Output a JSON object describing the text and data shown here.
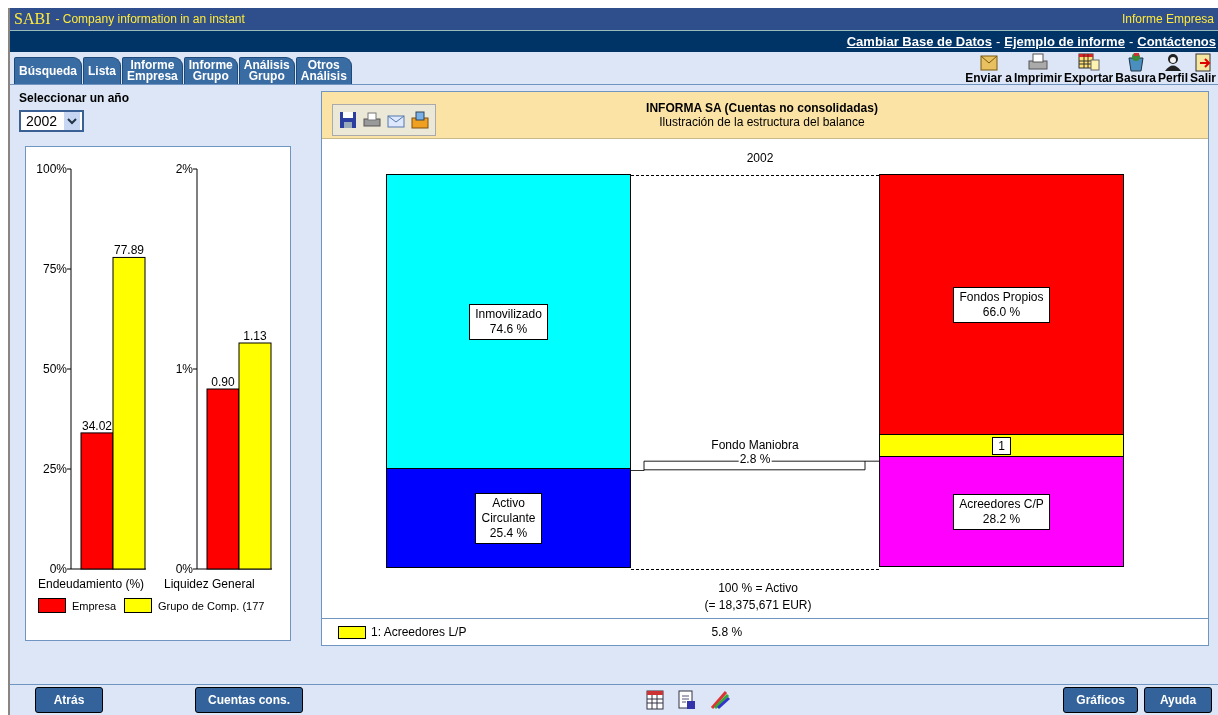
{
  "header": {
    "brand": "SABI",
    "tagline": "- Company information in an instant",
    "section": "Informe Empresa"
  },
  "nav_links": [
    {
      "kind": "link",
      "text": "Cambiar Base de Datos"
    },
    {
      "kind": "separator",
      "text": "-"
    },
    {
      "kind": "link",
      "text": "Ejemplo de informe"
    },
    {
      "kind": "separator",
      "text": "-"
    },
    {
      "kind": "link",
      "text": "Contáctenos"
    }
  ],
  "tabs": [
    {
      "lines": [
        "Búsqueda"
      ]
    },
    {
      "lines": [
        "Lista"
      ]
    },
    {
      "lines": [
        "Informe",
        "Empresa"
      ]
    },
    {
      "lines": [
        "Informe",
        "Grupo"
      ]
    },
    {
      "lines": [
        "Análisis",
        "Grupo"
      ]
    },
    {
      "lines": [
        "Otros",
        "Análisis"
      ]
    }
  ],
  "toolbar": [
    {
      "kind": "send",
      "label": "Enviar a"
    },
    {
      "kind": "print",
      "label": "Imprimir"
    },
    {
      "kind": "export",
      "label": "Exportar"
    },
    {
      "kind": "trash",
      "label": "Basura"
    },
    {
      "kind": "profile",
      "label": "Perfil"
    },
    {
      "kind": "exit",
      "label": "Salir"
    }
  ],
  "year_selector": {
    "label": "Seleccionar un año",
    "value": "2002"
  },
  "ratio_charts": [
    {
      "chart_data": {
        "type": "bar",
        "xlabel": "Endeudamiento (%)",
        "ylim": [
          0,
          100
        ],
        "yticks": [
          {
            "value": 0,
            "label": "0%"
          },
          {
            "value": 25,
            "label": "25%"
          },
          {
            "value": 50,
            "label": "50%"
          },
          {
            "value": 75,
            "label": "75%"
          },
          {
            "value": 100,
            "label": "100%"
          }
        ],
        "value_labels": [
          "34.02",
          "77.89"
        ],
        "series": [
          {
            "name": "Empresa",
            "color": "#ff0000",
            "values": [
              34.02
            ]
          },
          {
            "name": "Grupo de Comp. (177",
            "color": "#ffff00",
            "values": [
              77.89
            ]
          }
        ]
      }
    },
    {
      "chart_data": {
        "type": "bar",
        "xlabel": "Liquidez General",
        "ylim": [
          0,
          2
        ],
        "yticks": [
          {
            "value": 0,
            "label": "0%"
          },
          {
            "value": 1,
            "label": "1%"
          },
          {
            "value": 2,
            "label": "2%"
          }
        ],
        "value_labels": [
          "0.90",
          "1.13"
        ],
        "series": [
          {
            "color": "#ff0000",
            "values": [
              0.9
            ]
          },
          {
            "color": "#ffff00",
            "values": [
              1.13
            ]
          }
        ]
      }
    }
  ],
  "report": {
    "title": "INFORMA SA (Cuentas no consolidadas)",
    "subtitle": "Ilustración de la estructura del balance",
    "tools": [
      {
        "kind": "save"
      },
      {
        "kind": "print"
      },
      {
        "kind": "email"
      },
      {
        "kind": "fax"
      }
    ]
  },
  "balance": {
    "year": "2002",
    "assets": [
      {
        "kind": "block",
        "lines": [
          "Inmovilizado"
        ],
        "value": "74.6 %",
        "color": "#00ffff"
      },
      {
        "kind": "block",
        "lines": [
          "Activo",
          "Circulante"
        ],
        "value": "25.4 %",
        "color": "#0000ff"
      }
    ],
    "liabilities": [
      {
        "kind": "block",
        "lines": [
          "Fondos Propios"
        ],
        "value": "66.0 %",
        "color": "#ff0000"
      },
      {
        "kind": "note",
        "lines": [
          "1"
        ],
        "color": "#ffff00"
      },
      {
        "kind": "block",
        "lines": [
          "Acreedores C/P"
        ],
        "value": "28.2 %",
        "color": "#ff00ff"
      }
    ],
    "working_capital": {
      "label": "Fondo Maniobra",
      "value": "2.8 %"
    },
    "total": {
      "label": "100 % = Activo",
      "value": "(= 18,375,671  EUR)"
    }
  },
  "footnote": {
    "label": "1: Acreedores L/P",
    "color": "#ffff00",
    "value": "5.8 %"
  },
  "footer": {
    "left_buttons": [
      "Atrás",
      "Cuentas cons."
    ],
    "icons": [
      {
        "kind": "table"
      },
      {
        "kind": "pdf"
      },
      {
        "kind": "colors"
      }
    ],
    "right_buttons": [
      "Gráficos",
      "Ayuda"
    ]
  }
}
